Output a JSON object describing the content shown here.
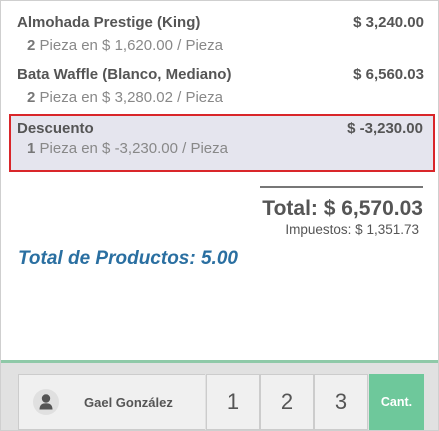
{
  "order": {
    "lines": [
      {
        "product": "Almohada Prestige (King)",
        "price": "$ 3,240.00",
        "quantity": "2",
        "unit_text": "Pieza en $ 1,620.00 / Pieza",
        "selected": false
      },
      {
        "product": "Bata Waffle (Blanco, Mediano)",
        "price": "$ 6,560.03",
        "quantity": "2",
        "unit_text": "Pieza en $ 3,280.02 / Pieza",
        "selected": false
      },
      {
        "product": "Descuento",
        "price": "$ -3,230.00",
        "quantity": "1",
        "unit_text": "Pieza en $ -3,230.00 / Pieza",
        "selected": true
      }
    ],
    "total": "Total: $ 6,570.03",
    "taxes": "Impuestos: $ 1,351.73",
    "product_count": "Total de Productos: 5.00"
  },
  "controls": {
    "customer_name": "Gael González",
    "customer_icon": "user-icon",
    "numpad_keys": [
      "1",
      "2",
      "3"
    ],
    "mode_key": "Cant."
  },
  "colors": {
    "selected_border": "#d9262a",
    "selected_background": "#e5e5ee",
    "product_count_text": "#2a6fa1",
    "accent_green": "#6ec89b"
  }
}
